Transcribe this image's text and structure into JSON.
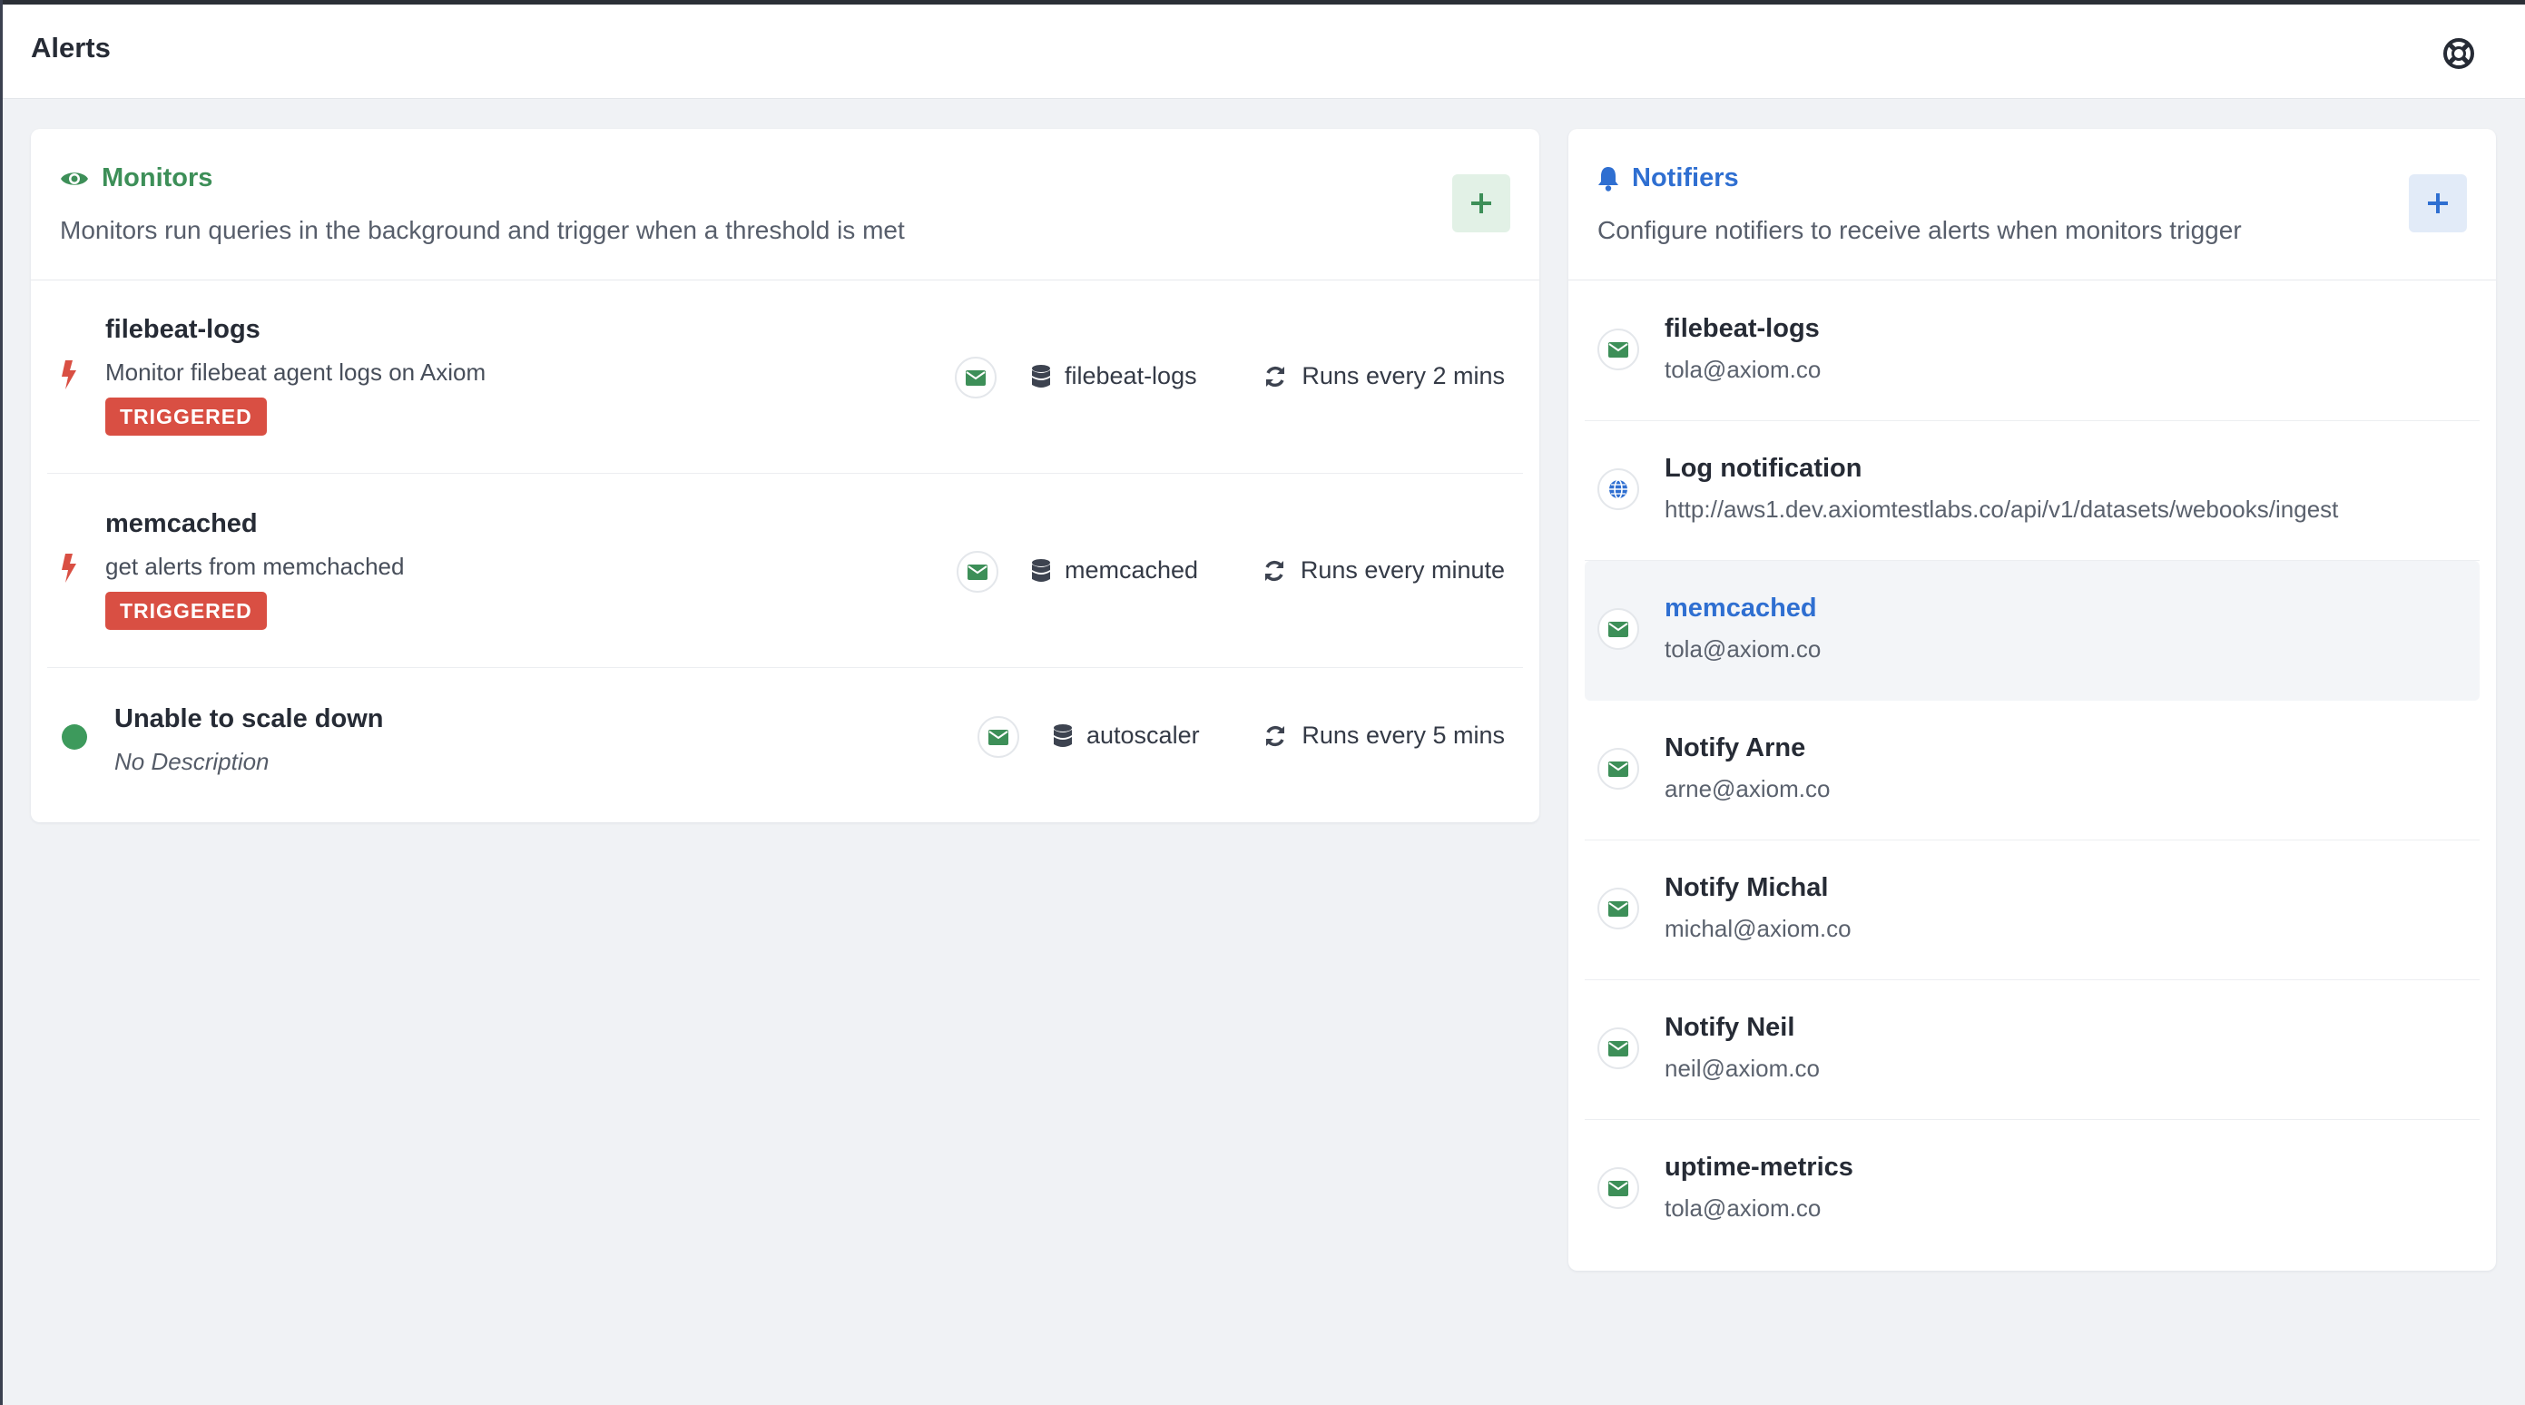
{
  "header": {
    "title": "Alerts",
    "help_icon": "lifebuoy-icon"
  },
  "colors": {
    "monitors_accent": "#3d8f58",
    "notifiers_accent": "#2f6fd1",
    "triggered_badge": "#d94f43",
    "ok_status": "#3d9a5c",
    "page_background": "#f0f2f5"
  },
  "monitors": {
    "title": "Monitors",
    "description": "Monitors run queries in the background and trigger when a threshold is met",
    "add_icon": "plus-icon",
    "items": [
      {
        "name": "filebeat-logs",
        "description": "Monitor filebeat agent logs on Axiom",
        "status": "TRIGGERED",
        "dataset": "filebeat-logs",
        "schedule": "Runs every 2 mins"
      },
      {
        "name": "memcached",
        "description": "get alerts from memchached",
        "status": "TRIGGERED",
        "dataset": "memcached",
        "schedule": "Runs every minute"
      },
      {
        "name": "Unable to scale down",
        "description": "No Description",
        "status": "ok",
        "dataset": "autoscaler",
        "schedule": "Runs every 5 mins"
      }
    ]
  },
  "notifiers": {
    "title": "Notifiers",
    "description": "Configure notifiers to receive alerts when monitors trigger",
    "add_icon": "plus-icon",
    "items": [
      {
        "name": "filebeat-logs",
        "address": "tola@axiom.co",
        "type": "email"
      },
      {
        "name": "Log notification",
        "address": "http://aws1.dev.axiomtestlabs.co/api/v1/datasets/webooks/ingest",
        "type": "webhook"
      },
      {
        "name": "memcached",
        "address": "tola@axiom.co",
        "type": "email",
        "selected": true
      },
      {
        "name": "Notify Arne",
        "address": "arne@axiom.co",
        "type": "email"
      },
      {
        "name": "Notify Michal",
        "address": "michal@axiom.co",
        "type": "email"
      },
      {
        "name": "Notify Neil",
        "address": "neil@axiom.co",
        "type": "email"
      },
      {
        "name": "uptime-metrics",
        "address": "tola@axiom.co",
        "type": "email"
      }
    ]
  }
}
